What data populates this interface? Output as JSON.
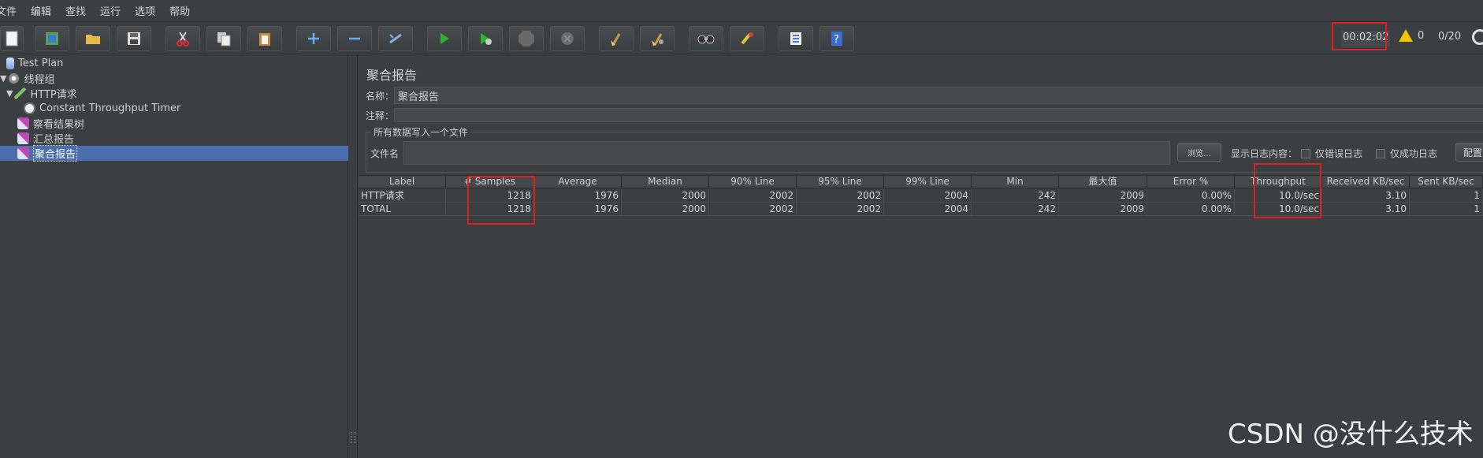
{
  "menu": [
    "文件",
    "编辑",
    "查找",
    "运行",
    "选项",
    "帮助"
  ],
  "toolbar": {
    "buttons": [
      "new-icon",
      "templates-icon",
      "open-icon",
      "save-icon",
      "cut-icon",
      "copy-icon",
      "paste-icon",
      "expand-icon",
      "collapse-icon",
      "toggle-icon",
      "start-icon",
      "start-no-pause-icon",
      "stop-icon",
      "shutdown-icon",
      "clear-icon",
      "clear-all-icon",
      "search-icon",
      "reset-search-icon",
      "function-helper-icon",
      "help-icon"
    ],
    "timer": "00:02:02",
    "warnings": "0",
    "threads": "0/20"
  },
  "tree": [
    {
      "label": "Test Plan",
      "icon": "flask-icon",
      "level": 0
    },
    {
      "label": "线程组",
      "icon": "gear-icon",
      "level": 0
    },
    {
      "label": "HTTP请求",
      "icon": "pen-icon",
      "level": 1
    },
    {
      "label": "Constant Throughput Timer",
      "icon": "stopwatch-icon",
      "level": 2
    },
    {
      "label": "察看结果树",
      "icon": "chart-icon",
      "level": 1
    },
    {
      "label": "汇总报告",
      "icon": "chart-icon",
      "level": 1
    },
    {
      "label": "聚合报告",
      "icon": "chart-icon",
      "level": 1,
      "selected": true
    }
  ],
  "panel": {
    "title": "聚合报告",
    "name_label": "名称：",
    "name_value": "聚合报告",
    "comment_label": "注释：",
    "comment_value": "",
    "fileset_legend": "所有数据写入一个文件",
    "file_label": "文件名",
    "browse": "浏览...",
    "log_label": "显示日志内容：",
    "errors_only": "仅错误日志",
    "success_only": "仅成功日志",
    "configure": "配置"
  },
  "table": {
    "columns": [
      "Label",
      "# Samples",
      "Average",
      "Median",
      "90% Line",
      "95% Line",
      "99% Line",
      "Min",
      "最大值",
      "Error %",
      "Throughput",
      "Received KB/sec",
      "Sent KB/sec"
    ],
    "rows": [
      [
        "HTTP请求",
        "1218",
        "1976",
        "2000",
        "2002",
        "2002",
        "2004",
        "242",
        "2009",
        "0.00%",
        "10.0/sec",
        "3.10",
        "1"
      ],
      [
        "TOTAL",
        "1218",
        "1976",
        "2000",
        "2002",
        "2002",
        "2004",
        "242",
        "2009",
        "0.00%",
        "10.0/sec",
        "3.10",
        "1"
      ]
    ]
  },
  "watermark": "CSDN @没什么技术"
}
